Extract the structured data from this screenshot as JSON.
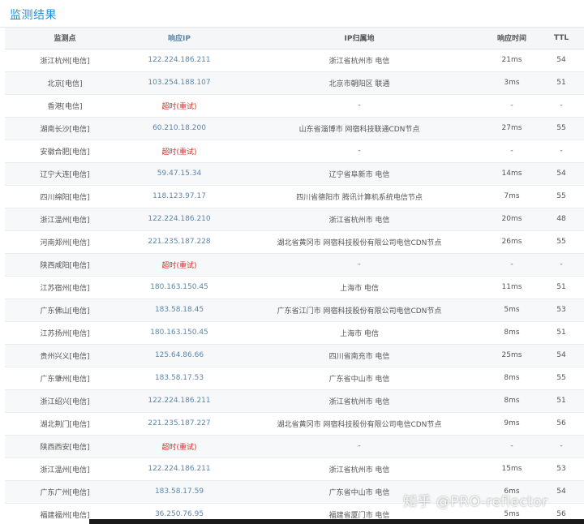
{
  "panel": {
    "title": "监测结果"
  },
  "columns": {
    "node": "监测点",
    "ip": "响应IP",
    "location": "IP归属地",
    "time": "响应时间",
    "ttl": "TTL"
  },
  "rows": [
    {
      "node": "浙江杭州[电信]",
      "ip": "122.224.186.211",
      "location": "浙江省杭州市 电信",
      "time": "21ms",
      "ttl": "54"
    },
    {
      "node": "北京[电信]",
      "ip": "103.254.188.107",
      "location": "北京市朝阳区 联通",
      "time": "3ms",
      "ttl": "51"
    },
    {
      "node": "香港[电信]",
      "ip": "超时(重试)",
      "location": "-",
      "time": "-",
      "ttl": "-",
      "timeout": true
    },
    {
      "node": "湖南长沙[电信]",
      "ip": "60.210.18.200",
      "location": "山东省淄博市 网宿科技联通CDN节点",
      "time": "27ms",
      "ttl": "55"
    },
    {
      "node": "安徽合肥[电信]",
      "ip": "超时(重试)",
      "location": "-",
      "time": "-",
      "ttl": "-",
      "timeout": true
    },
    {
      "node": "辽宁大连[电信]",
      "ip": "59.47.15.34",
      "location": "辽宁省阜新市 电信",
      "time": "14ms",
      "ttl": "54"
    },
    {
      "node": "四川绵阳[电信]",
      "ip": "118.123.97.17",
      "location": "四川省德阳市 腾讯计算机系统电信节点",
      "time": "7ms",
      "ttl": "55"
    },
    {
      "node": "浙江温州[电信]",
      "ip": "122.224.186.210",
      "location": "浙江省杭州市 电信",
      "time": "20ms",
      "ttl": "48"
    },
    {
      "node": "河南郑州[电信]",
      "ip": "221.235.187.228",
      "location": "湖北省黄冈市 网宿科技股份有限公司电信CDN节点",
      "time": "26ms",
      "ttl": "55"
    },
    {
      "node": "陕西咸阳[电信]",
      "ip": "超时(重试)",
      "location": "-",
      "time": "-",
      "ttl": "-",
      "timeout": true
    },
    {
      "node": "江苏宿州[电信]",
      "ip": "180.163.150.45",
      "location": "上海市 电信",
      "time": "11ms",
      "ttl": "51"
    },
    {
      "node": "广东佛山[电信]",
      "ip": "183.58.18.45",
      "location": "广东省江门市 网宿科技股份有限公司电信CDN节点",
      "time": "5ms",
      "ttl": "53"
    },
    {
      "node": "江苏扬州[电信]",
      "ip": "180.163.150.45",
      "location": "上海市 电信",
      "time": "8ms",
      "ttl": "51"
    },
    {
      "node": "贵州兴义[电信]",
      "ip": "125.64.86.66",
      "location": "四川省南充市 电信",
      "time": "25ms",
      "ttl": "54"
    },
    {
      "node": "广东肇州[电信]",
      "ip": "183.58.17.53",
      "location": "广东省中山市 电信",
      "time": "8ms",
      "ttl": "55"
    },
    {
      "node": "浙江绍兴[电信]",
      "ip": "122.224.186.211",
      "location": "浙江省杭州市 电信",
      "time": "8ms",
      "ttl": "51"
    },
    {
      "node": "湖北荆门[电信]",
      "ip": "221.235.187.227",
      "location": "湖北省黄冈市 网宿科技股份有限公司电信CDN节点",
      "time": "9ms",
      "ttl": "56"
    },
    {
      "node": "陕西西安[电信]",
      "ip": "超时(重试)",
      "location": "-",
      "time": "-",
      "ttl": "-",
      "timeout": true
    },
    {
      "node": "浙江温州[电信]",
      "ip": "122.224.186.211",
      "location": "浙江省杭州市 电信",
      "time": "15ms",
      "ttl": "53"
    },
    {
      "node": "广东广州[电信]",
      "ip": "183.58.17.59",
      "location": "广东省中山市 电信",
      "time": "6ms",
      "ttl": "54"
    },
    {
      "node": "福建福州[电信]",
      "ip": "36.250.76.95",
      "location": "福建省厦门市 电信",
      "time": "5ms",
      "ttl": "56"
    }
  ],
  "watermark": {
    "text": "知乎 @PRO-reflector"
  },
  "colors": {
    "title": "#1e8fd6",
    "ip": "#5a86ad",
    "timeout": "#d0342c",
    "header_bg": "#f5f6f7"
  }
}
